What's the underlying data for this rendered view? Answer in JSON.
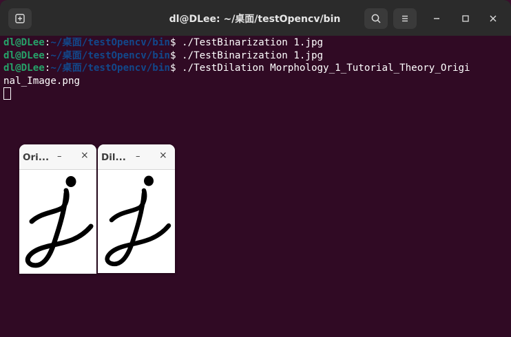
{
  "window": {
    "title": "dl@DLee: ~/桌面/testOpencv/bin",
    "new_tab_icon": "new-tab-icon",
    "search_icon": "search-icon",
    "menu_icon": "hamburger-menu-icon",
    "minimize_icon": "minimize-icon",
    "maximize_icon": "maximize-icon",
    "close_icon": "close-icon"
  },
  "terminal": {
    "lines": [
      {
        "user": "dl@DLee",
        "sep": ":",
        "path": "~/桌面/testOpencv/bin",
        "prompt": "$ ",
        "cmd": "./TestBinarization 1.jpg"
      },
      {
        "user": "dl@DLee",
        "sep": ":",
        "path": "~/桌面/testOpencv/bin",
        "prompt": "$ ",
        "cmd": "./TestBinarization 1.jpg"
      },
      {
        "user": "dl@DLee",
        "sep": ":",
        "path": "~/桌面/testOpencv/bin",
        "prompt": "$ ",
        "cmd": "./TestDilation Morphology_1_Tutorial_Theory_Origi"
      }
    ],
    "wrap_line": "nal_Image.png"
  },
  "popups": [
    {
      "title": "Ori...",
      "min": "–",
      "close": "×"
    },
    {
      "title": "Dil...",
      "min": "–",
      "close": "×"
    }
  ],
  "colors": {
    "terminal_bg": "#300a24",
    "user_green": "#26a269",
    "path_blue": "#12488b",
    "titlebar": "#2b2b2b"
  }
}
